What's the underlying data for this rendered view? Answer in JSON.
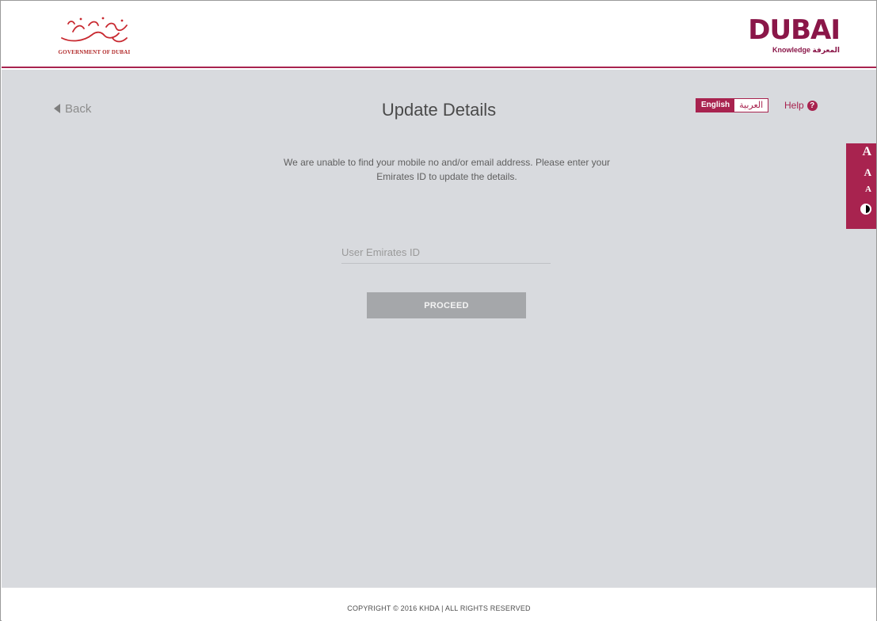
{
  "header": {
    "gov_logo_text": "GOVERNMENT OF DUBAI",
    "gov_logo_arabic": "حكومة دبي",
    "brand_logo_word": "DUBAI",
    "brand_logo_sub": "Knowledge المعرفة",
    "brand_color": "#a8234f"
  },
  "main": {
    "back_label": "Back",
    "title": "Update Details",
    "language": {
      "english_label": "English",
      "arabic_label": "العربية",
      "selected": "English"
    },
    "help_label": "Help",
    "help_icon": "question-circle-icon",
    "description": "We are unable to find your mobile no and/or email address. Please enter your Emirates ID to update the details.",
    "emirates_id": {
      "placeholder": "User Emirates ID",
      "value": ""
    },
    "proceed_label": "PROCEED"
  },
  "accessibility": {
    "font_large": "A",
    "font_medium": "A",
    "font_small": "A",
    "contrast_icon": "contrast-icon"
  },
  "footer": {
    "copyright": "COPYRIGHT © 2016 KHDA | ALL RIGHTS RESERVED"
  }
}
